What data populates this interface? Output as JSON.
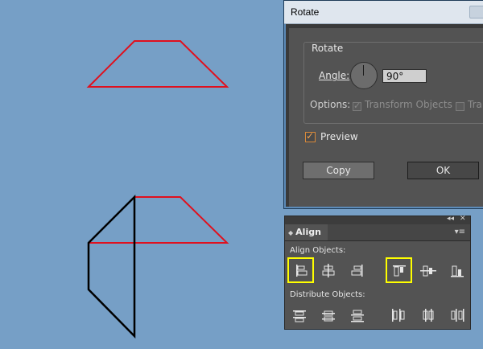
{
  "dialog": {
    "title": "Rotate",
    "group_label": "Rotate",
    "angle_label": "Angle:",
    "angle_value": "90°",
    "options_label": "Options:",
    "transform_objects_label": "Transform Objects",
    "transform_patterns_label": "Tra",
    "preview_label": "Preview",
    "copy_button": "Copy",
    "ok_button": "OK"
  },
  "panel": {
    "tab_label": "Align",
    "align_objects_label": "Align Objects:",
    "distribute_objects_label": "Distribute Objects:"
  },
  "colors": {
    "canvas_bg": "#769fc6",
    "trapezoid_stroke": "#e0101e",
    "rotated_stroke": "#000000",
    "highlight": "#ffff00",
    "preview_check": "#d8893a"
  },
  "icons": {
    "align_objects": [
      "align-left-icon",
      "align-horizontal-center-icon",
      "align-right-icon",
      "align-top-icon",
      "align-vertical-center-icon",
      "align-bottom-icon"
    ],
    "distribute_objects": [
      "distribute-top-icon",
      "distribute-vertical-center-icon",
      "distribute-bottom-icon",
      "distribute-left-icon",
      "distribute-horizontal-center-icon",
      "distribute-right-icon"
    ],
    "highlighted": [
      "align-left-icon",
      "align-top-icon"
    ]
  }
}
